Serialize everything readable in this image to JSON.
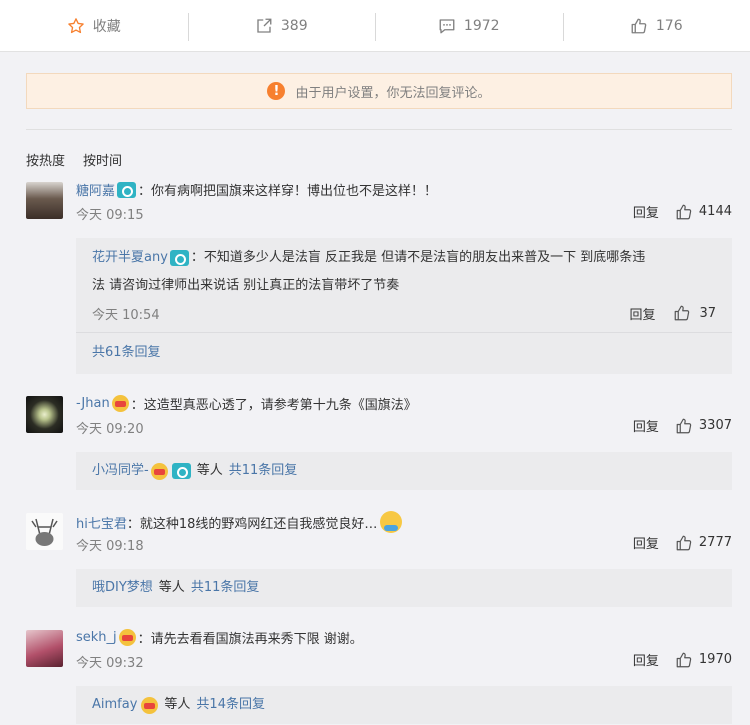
{
  "topbar": {
    "favorite_label": "收藏",
    "repost_count": "389",
    "comment_count": "1972",
    "like_count": "176"
  },
  "notice": {
    "icon_text": "!",
    "text": "由于用户设置，你无法回复评论。"
  },
  "sort": {
    "by_hot": "按热度",
    "by_time": "按时间"
  },
  "reply_label": "回复",
  "comments": [
    {
      "user": "糖阿嘉",
      "text": "：你有病啊把国旗来这样穿！博出位也不是这样！！",
      "time": "今天 09:15",
      "likes": "4144",
      "sub": {
        "user": "花开半夏any",
        "text_line1": "：不知道多少人是法盲 反正我是 但请不是法盲的朋友出来普及一下 到底哪条违",
        "text_line2": "法 请咨询过律师出来说话 别让真正的法盲带坏了节奏",
        "time": "今天 10:54",
        "likes": "37",
        "total": "共61条回复"
      }
    },
    {
      "user": "-Jhan",
      "text": "：这造型真恶心透了，请参考第十九条《国旗法》",
      "time": "今天 09:20",
      "likes": "3307",
      "sub": {
        "user": "小冯同学-",
        "etc": "等人",
        "total": "共11条回复"
      }
    },
    {
      "user": "hi七宝君",
      "text": "：就这种18线的野鸡网红还自我感觉良好…",
      "time": "今天 09:18",
      "likes": "2777",
      "sub": {
        "user": "哦DIY梦想",
        "etc": "等人",
        "total": "共11条回复"
      }
    },
    {
      "user": "sekh_j",
      "text": "：请先去看看国旗法再来秀下限 谢谢。",
      "time": "今天 09:32",
      "likes": "1970",
      "sub": {
        "user": "Aimfay",
        "etc": "等人",
        "total": "共14条回复"
      }
    }
  ],
  "colors": {
    "link": "#4a76a8",
    "notice_bg": "#fdf0e3",
    "notice_icon": "#f7802f",
    "star": "#f7802f"
  }
}
